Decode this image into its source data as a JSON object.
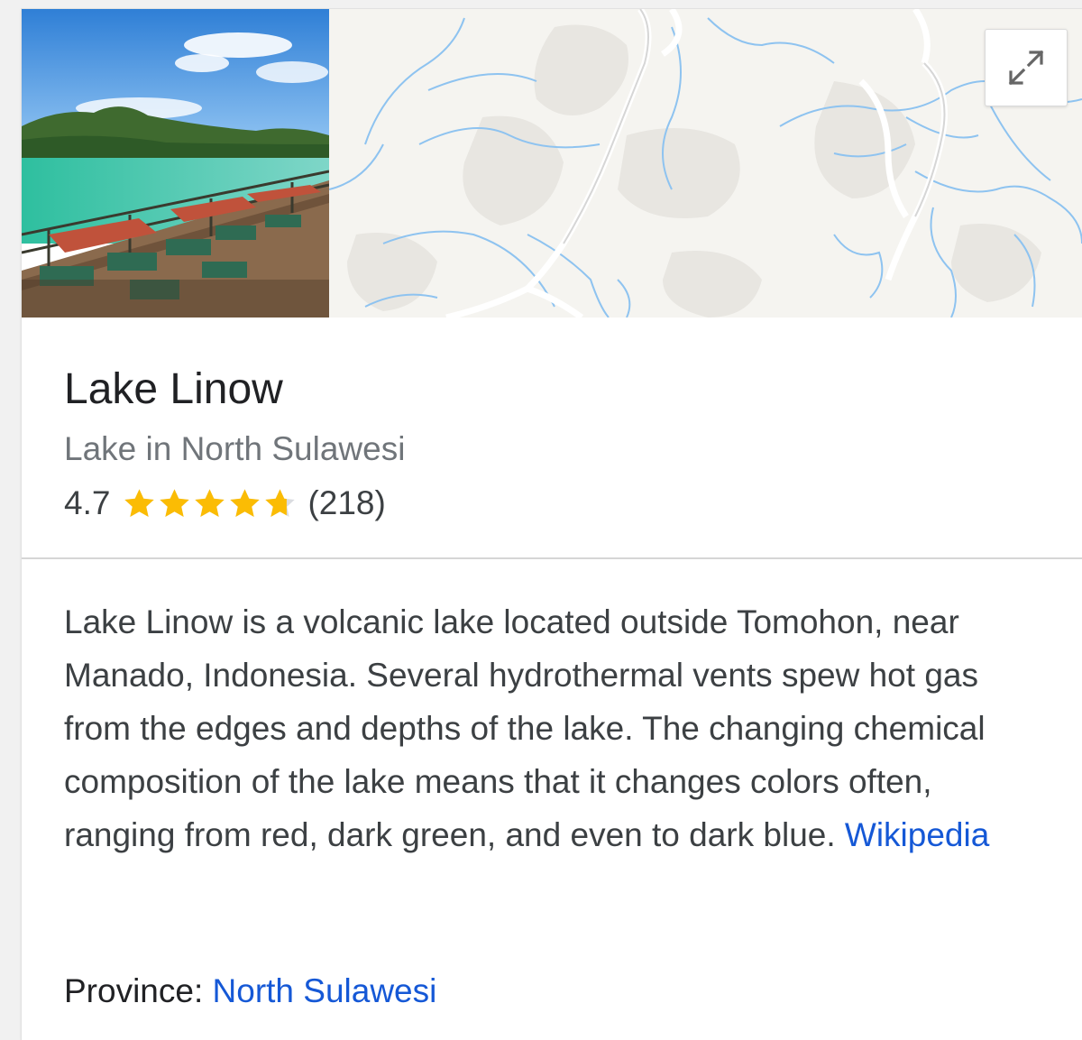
{
  "media": {
    "photo_alt": "Lake Linow",
    "expand_icon": "expand-arrows-icon"
  },
  "place": {
    "title": "Lake Linow",
    "subtitle": "Lake in North Sulawesi",
    "rating_value": "4.7",
    "rating_stars": 4.7,
    "review_count": "(218)",
    "star_color": "#fbbc04"
  },
  "description": {
    "text": "Lake Linow is a volcanic lake located outside Tomohon, near Manado, Indonesia. Several hydrothermal vents spew hot gas from the edges and depths of the lake. The changing chemical composition of the lake means that it changes colors often, ranging from red, dark green, and even to dark blue.",
    "source_label": "Wikipedia"
  },
  "facts": {
    "province_label": "Province:",
    "province_value": "North Sulawesi"
  },
  "colors": {
    "link": "#1558d6",
    "map_water": "#8ec3f0"
  }
}
